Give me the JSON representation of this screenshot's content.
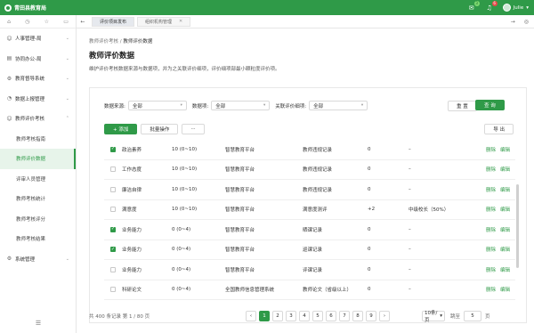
{
  "app": {
    "title": "青田县教育局"
  },
  "topbar": {
    "msg_badge": "3",
    "bell_badge": "6",
    "user": "Julie"
  },
  "sidebar": {
    "items": [
      {
        "label": "人事管理-局",
        "icon": "person-icon"
      },
      {
        "label": "协同办公-局",
        "icon": "document-icon"
      },
      {
        "label": "教育督导系统",
        "icon": "gear-icon"
      },
      {
        "label": "数据上报管理",
        "icon": "chart-icon"
      },
      {
        "label": "教师评价考核",
        "icon": "person-icon"
      }
    ],
    "sub_items": [
      "教师考核指南",
      "教师评价数据",
      "评审人员管理",
      "教师考核统计",
      "教师考核评分",
      "教师考核结果"
    ],
    "system": "系统管理"
  },
  "tabs": [
    {
      "label": "评价项目发布"
    },
    {
      "label": "组织机构管理"
    }
  ],
  "breadcrumb": {
    "parent": "教师评价考核",
    "separator": "/",
    "current": "教师评价数据"
  },
  "page": {
    "title": "教师评价数据",
    "description": "维护评价考核数据来源与数据项，并为之关联评价细项，评价细项部最小颗粒度评价项。"
  },
  "filters": [
    {
      "label": "数据来源:",
      "value": "全部"
    },
    {
      "label": "数据项:",
      "value": "全部"
    },
    {
      "label": "关联评价细项:",
      "value": "全部"
    }
  ],
  "buttons": {
    "reset": "重 置",
    "search": "查 询",
    "add": "+ 添加",
    "batch": "批量操作",
    "more": "···",
    "export": "导 出"
  },
  "table": {
    "rows": [
      {
        "checked": true,
        "name": "政治素养",
        "weight": "10 (0~10)",
        "source": "智慧教育平台",
        "basis": "教师违规记录",
        "score": "0",
        "note": "–"
      },
      {
        "checked": false,
        "name": "工作态度",
        "weight": "10 (0~10)",
        "source": "智慧教育平台",
        "basis": "教师违规记录",
        "score": "0",
        "note": "–"
      },
      {
        "checked": false,
        "name": "廉洁自律",
        "weight": "10 (0~10)",
        "source": "智慧教育平台",
        "basis": "教师违规记录",
        "score": "0",
        "note": "–"
      },
      {
        "checked": false,
        "name": "满意度",
        "weight": "10 (0~10)",
        "source": "智慧教育平台",
        "basis": "满意度测评",
        "score": "+2",
        "note": "中级校长（50%）"
      },
      {
        "checked": true,
        "name": "业务能力",
        "weight": "0 (0~4)",
        "source": "智慧教育平台",
        "basis": "晒课记录",
        "score": "0",
        "note": "–"
      },
      {
        "checked": true,
        "name": "业务能力",
        "weight": "0 (0~4)",
        "source": "智慧教育平台",
        "basis": "巡课记录",
        "score": "0",
        "note": "–"
      },
      {
        "checked": false,
        "name": "业务能力",
        "weight": "0 (0~4)",
        "source": "智慧教育平台",
        "basis": "评课记录",
        "score": "0",
        "note": "–"
      },
      {
        "checked": false,
        "name": "科研论文",
        "weight": "0 (0~4)",
        "source": "全国教师信息管理系统",
        "basis": "教师论文（省级以上）",
        "score": "0",
        "note": "–"
      }
    ],
    "actions": {
      "delete": "删除",
      "edit": "编辑"
    }
  },
  "pagination": {
    "total": "共 400 条记录 第 1 / 80 页",
    "prev": "‹",
    "next": "›",
    "pages": [
      "1",
      "2",
      "3",
      "4",
      "5",
      "6",
      "7",
      "8",
      "9"
    ],
    "current": "1",
    "page_size": "10条/页",
    "jump_label": "跳至",
    "jump_value": "5",
    "jump_suffix": "页"
  },
  "colors": {
    "brand": "#2f9a48"
  }
}
